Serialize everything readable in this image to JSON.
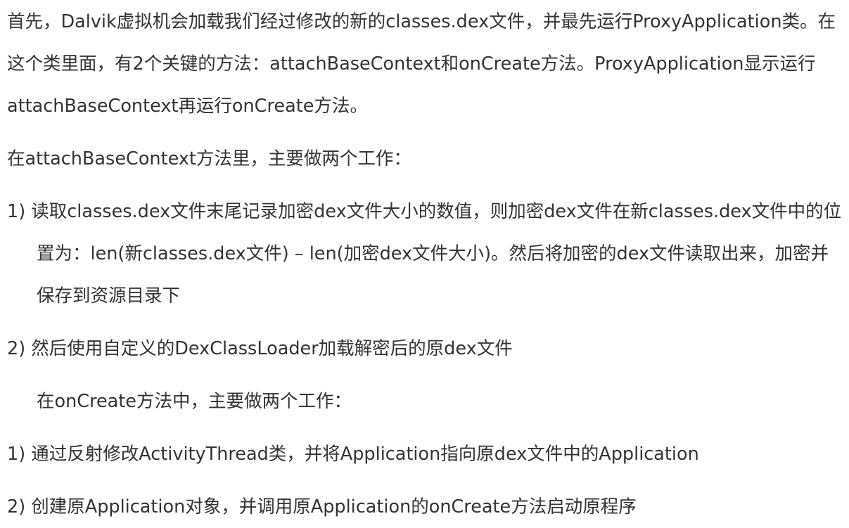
{
  "article": {
    "intro": "首先，Dalvik虚拟机会加载我们经过修改的新的classes.dex文件，并最先运行ProxyApplication类。在这个类里面，有2个关键的方法：attachBaseContext和onCreate方法。ProxyApplication显示运行attachBaseContext再运行onCreate方法。",
    "attach_heading": "在attachBaseContext方法里，主要做两个工作：",
    "attach_steps": [
      "1) 读取classes.dex文件末尾记录加密dex文件大小的数值，则加密dex文件在新classes.dex文件中的位置为：len(新classes.dex文件) – len(加密dex文件大小)。然后将加密的dex文件读取出来，加密并保存到资源目录下",
      "2) 然后使用自定义的DexClassLoader加载解密后的原dex文件"
    ],
    "oncreate_heading": "在onCreate方法中，主要做两个工作：",
    "oncreate_steps": [
      "1) 通过反射修改ActivityThread类，并将Application指向原dex文件中的Application",
      "2) 创建原Application对象，并调用原Application的onCreate方法启动原程序"
    ]
  }
}
